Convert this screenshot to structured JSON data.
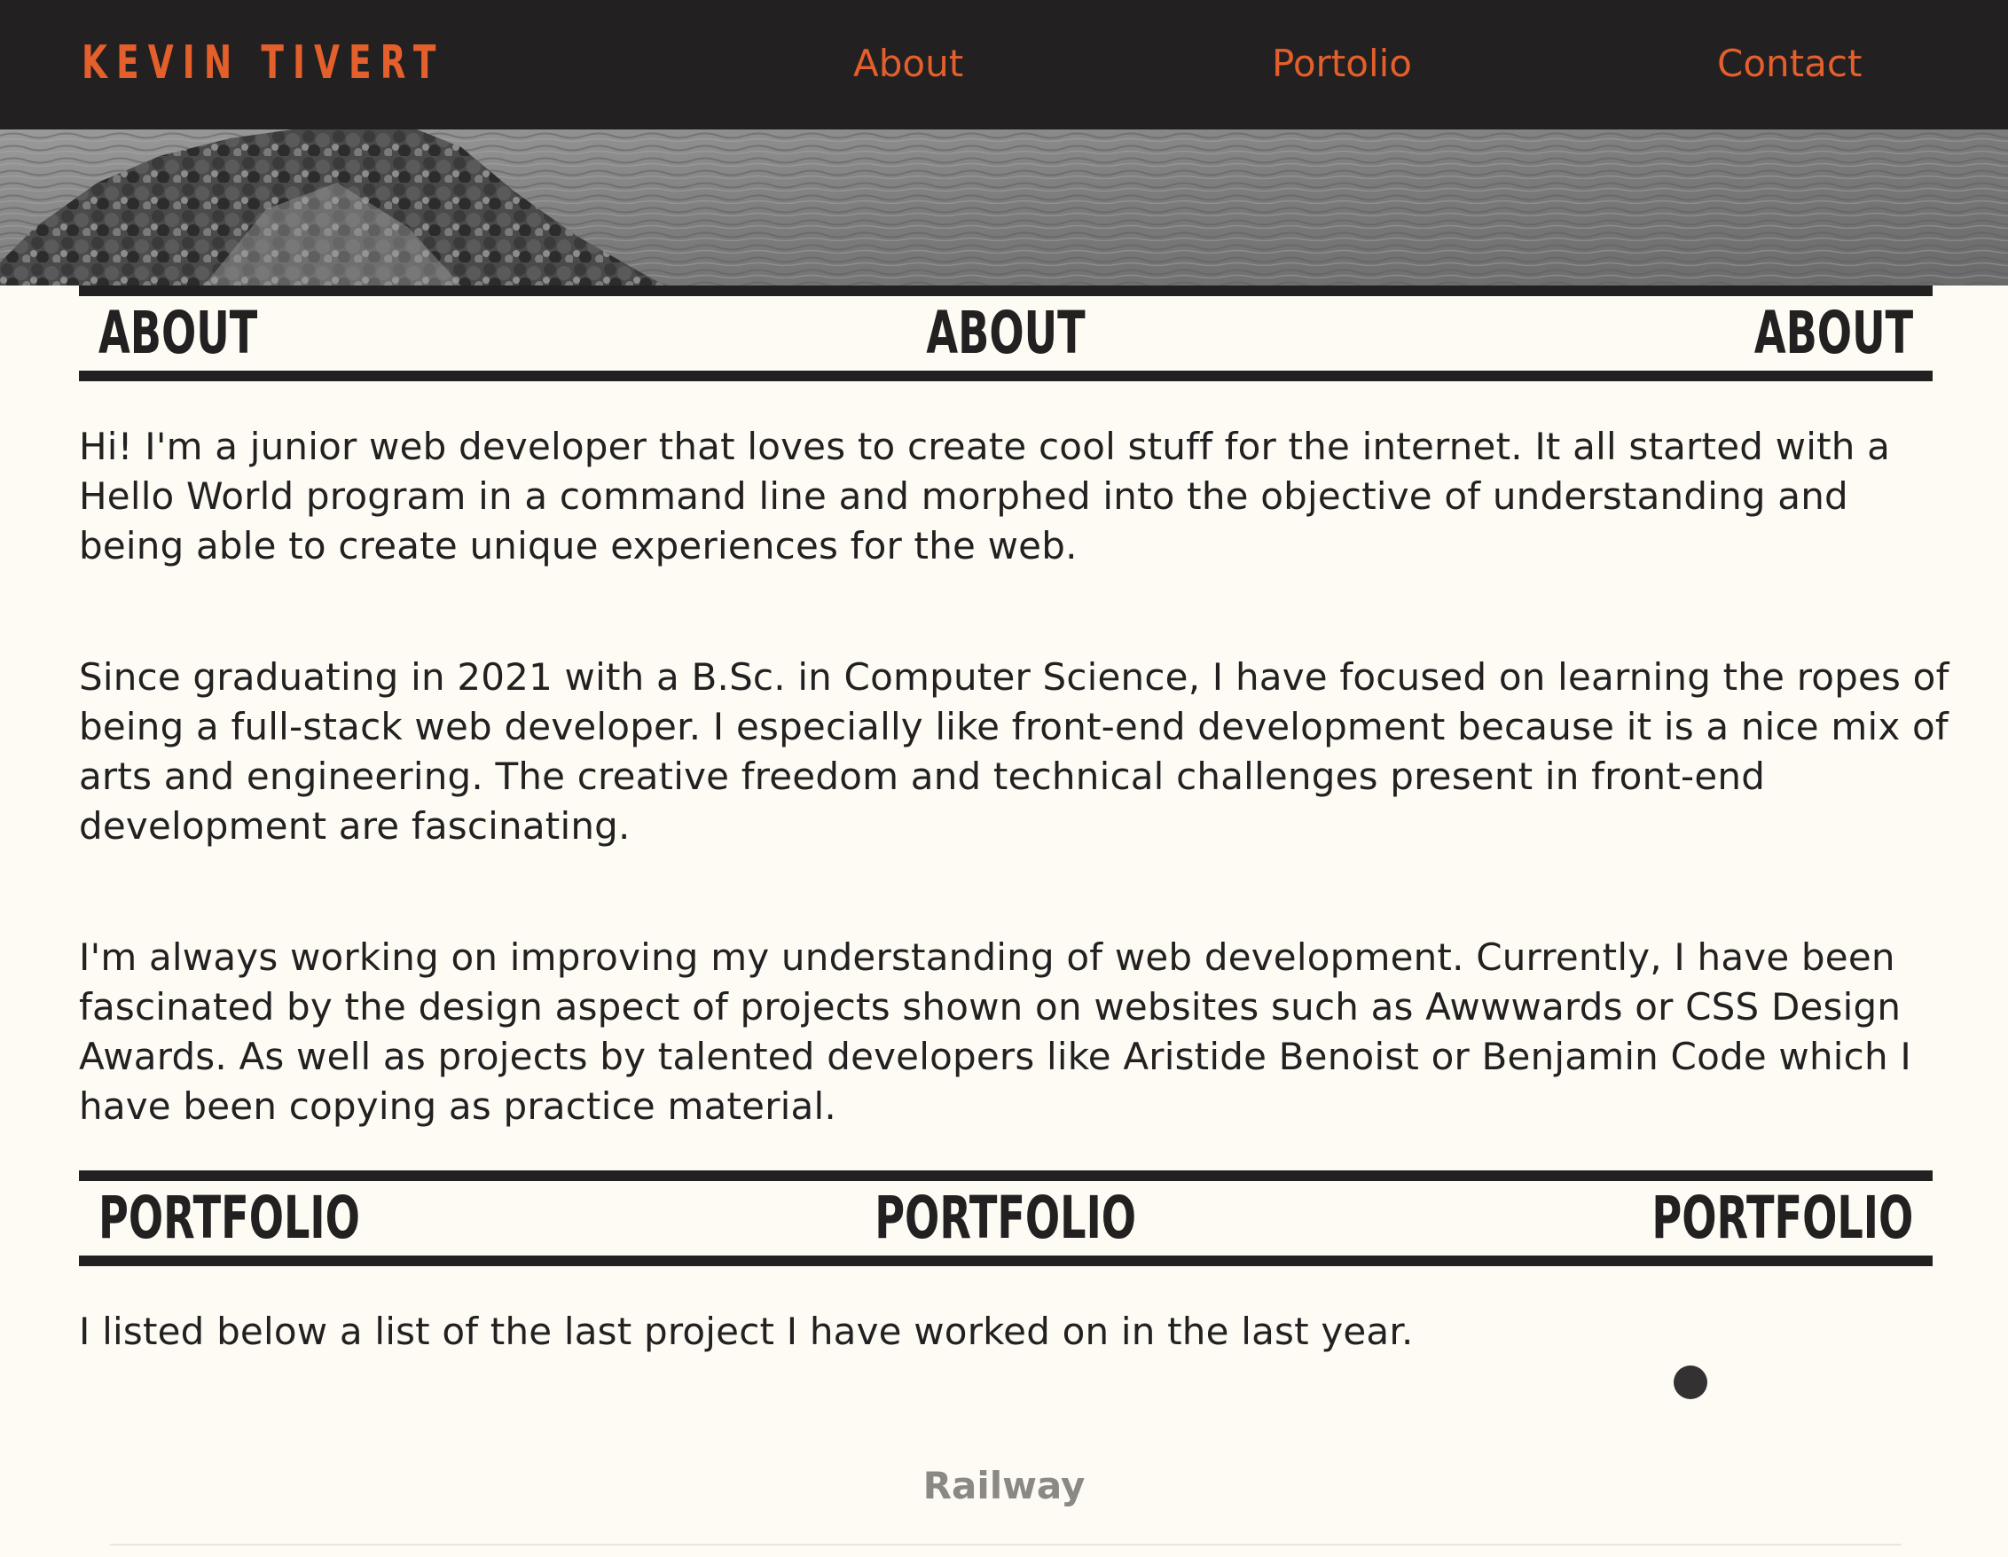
{
  "nav": {
    "brand": "KEVIN TIVERT",
    "links": [
      "About",
      "Portolio",
      "Contact"
    ]
  },
  "hero": {
    "image": "black-and-white photo of a tree-covered hill beside rippling water"
  },
  "about": {
    "heading": [
      "ABOUT",
      "ABOUT",
      "ABOUT"
    ],
    "paragraphs": [
      "Hi! I'm a junior web developer that loves to create cool stuff for the internet. It all started with a Hello World program in a command line and morphed into the objective of understanding and being able to create unique experiences for the web.",
      "Since graduating in 2021 with a B.Sc. in Computer Science, I have focused on learning the ropes of being a full-stack web developer. I especially like front-end development because it is a nice mix of arts and engineering. The creative freedom and technical challenges present in front-end development are fascinating.",
      "I'm always working on improving my understanding of web development. Currently, I have been fascinated by the design aspect of projects shown on websites such as Awwwards or CSS Design Awards. As well as projects by talented developers like Aristide Benoist or Benjamin Code which I have been copying as practice material."
    ]
  },
  "portfolio": {
    "heading": [
      "PORTFOLIO",
      "PORTFOLIO",
      "PORTFOLIO"
    ],
    "intro": "I listed below a list of the last project I have worked on in the last year.",
    "projects": [
      {
        "title": "Railway"
      }
    ]
  },
  "colors": {
    "dark": "#222020",
    "accent": "#e35f2b",
    "background": "#fdfbf3",
    "muted": "#8b8984"
  }
}
